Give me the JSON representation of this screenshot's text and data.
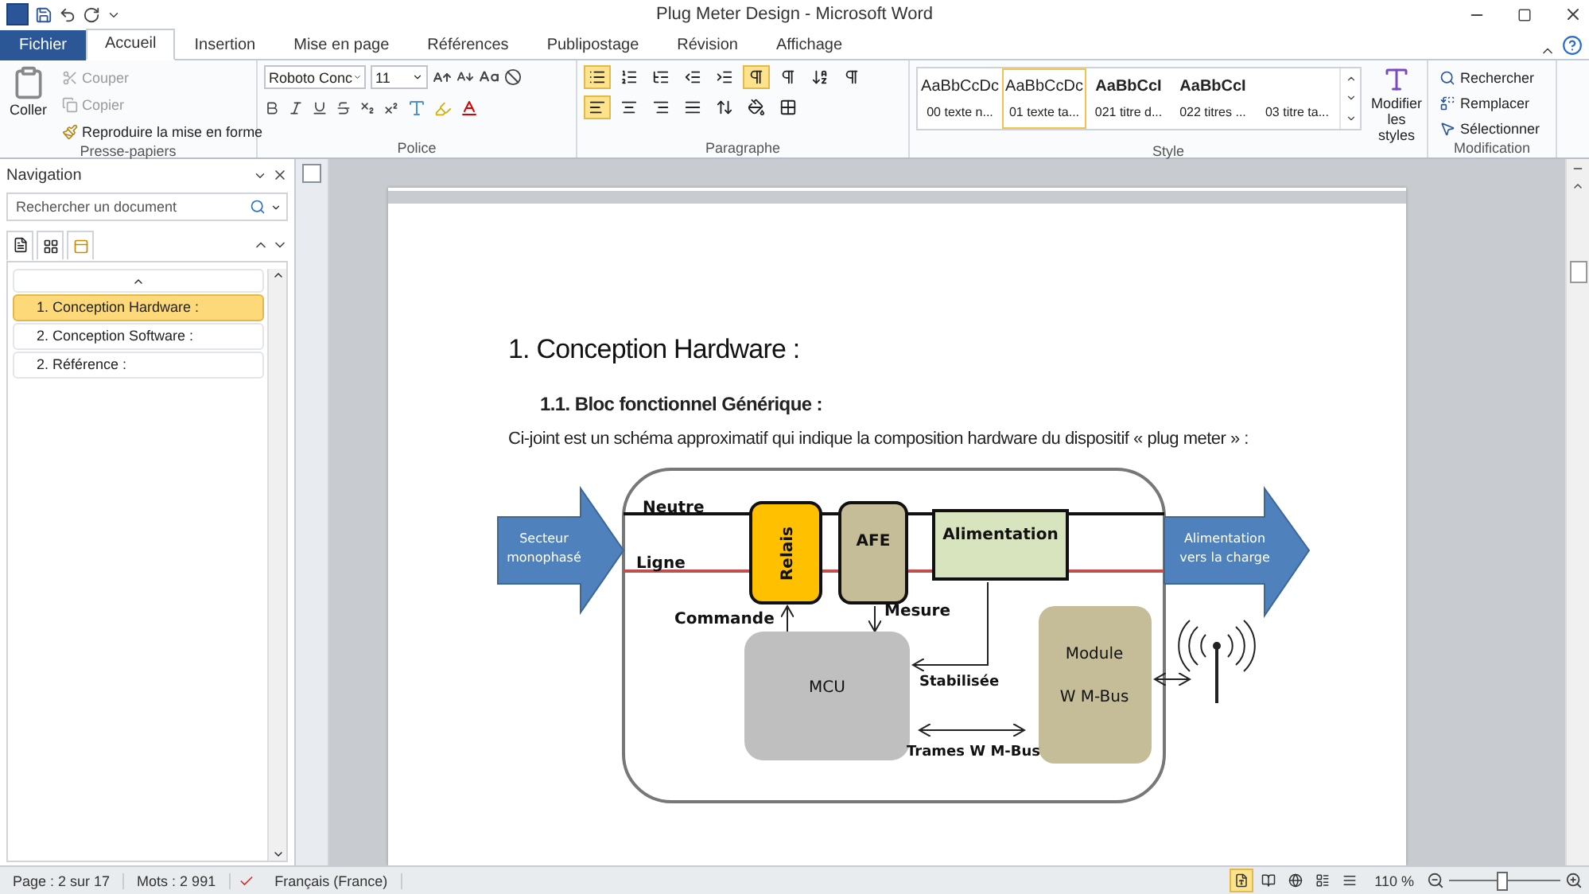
{
  "window": {
    "title": "Plug Meter Design - Microsoft Word"
  },
  "tabs": [
    {
      "label": "Fichier",
      "selected": false,
      "kind": "file"
    },
    {
      "label": "Accueil",
      "selected": true,
      "kind": "tab"
    },
    {
      "label": "Insertion",
      "selected": false,
      "kind": "tab"
    },
    {
      "label": "Mise en page",
      "selected": false,
      "kind": "tab"
    },
    {
      "label": "Références",
      "selected": false,
      "kind": "tab"
    },
    {
      "label": "Publipostage",
      "selected": false,
      "kind": "tab"
    },
    {
      "label": "Révision",
      "selected": false,
      "kind": "tab"
    },
    {
      "label": "Affichage",
      "selected": false,
      "kind": "tab"
    }
  ],
  "ribbon": {
    "clipboard": {
      "group": "Presse-papiers",
      "paste": "Coller",
      "items": [
        {
          "label": "Couper",
          "disabled": true,
          "kind": "cut"
        },
        {
          "label": "Copier",
          "disabled": true,
          "kind": "copy"
        },
        {
          "label": "Reproduire la mise en forme",
          "disabled": false,
          "kind": "brush"
        }
      ]
    },
    "font": {
      "group": "Police",
      "name": "Roboto Conc",
      "size": "11"
    },
    "paragraph": {
      "group": "Paragraphe",
      "row1": [
        {
          "kind": "bullets",
          "active": true
        },
        {
          "kind": "numbers",
          "active": false
        },
        {
          "kind": "multilevel",
          "active": false
        },
        {
          "kind": "outdent",
          "active": false
        },
        {
          "kind": "indent",
          "active": false
        },
        {
          "kind": "ltr",
          "active": true
        },
        {
          "kind": "rtl",
          "active": false
        },
        {
          "kind": "sort",
          "active": false
        },
        {
          "kind": "pilcrow",
          "active": false
        }
      ],
      "row2": [
        {
          "kind": "left",
          "active": true
        },
        {
          "kind": "center",
          "active": false
        },
        {
          "kind": "right",
          "active": false
        },
        {
          "kind": "justify",
          "active": false
        },
        {
          "kind": "spacing",
          "active": false
        },
        {
          "kind": "shading",
          "active": false
        },
        {
          "kind": "borders",
          "active": false
        }
      ]
    },
    "styles": {
      "group": "Style",
      "modify": "Modifier les styles",
      "items": [
        {
          "preview": "AaBbCcDc",
          "label": "00 texte n...",
          "selected": false,
          "bold": false
        },
        {
          "preview": "AaBbCcDc",
          "label": "01 texte ta...",
          "selected": true,
          "bold": false
        },
        {
          "preview": "AaBbCcI",
          "label": "021 titre d...",
          "selected": false,
          "bold": true
        },
        {
          "preview": "AaBbCcI",
          "label": "022 titres ...",
          "selected": false,
          "bold": true
        },
        {
          "label": "03 titre ta...",
          "selected": false
        }
      ]
    },
    "editing": {
      "group": "Modification",
      "items": [
        {
          "label": "Rechercher",
          "kind": "find"
        },
        {
          "label": "Remplacer",
          "kind": "replace"
        },
        {
          "label": "Sélectionner",
          "kind": "select"
        }
      ]
    }
  },
  "navigation": {
    "title": "Navigation",
    "search": {
      "placeholder": "Rechercher un document"
    },
    "headings": [
      {
        "label": "1. Conception Hardware :",
        "selected": true
      },
      {
        "label": "2. Conception Software :",
        "selected": false
      },
      {
        "label": "2. Référence :",
        "selected": false
      }
    ]
  },
  "document": {
    "heading1": "1.  Conception Hardware :",
    "heading2": "1.1. Bloc fonctionnel Générique :",
    "paragraph": "Ci-joint est un schéma approximatif qui indique la composition hardware du dispositif « plug meter » :",
    "diagram": {
      "input": [
        "Secteur",
        "monophasé"
      ],
      "output": [
        "Alimentation",
        "vers la charge"
      ],
      "neutral": "Neutre",
      "line": "Ligne",
      "relay": "Relais",
      "afe": "AFE",
      "power": "Alimentation",
      "command": "Commande",
      "measure": "Mesure",
      "stabilized": "Stabilisée",
      "mcu": "MCU",
      "module": [
        "Module",
        "W M-Bus"
      ],
      "frames": "Trames W M-Bus"
    }
  },
  "status_bar": {
    "page": "Page : 2 sur 17",
    "words": "Mots : 2 991",
    "language": "Français (France)",
    "zoom": "110 %",
    "level": 0.47
  }
}
